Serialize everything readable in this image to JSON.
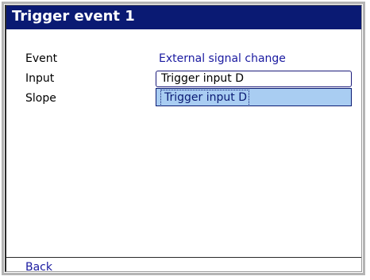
{
  "dialog": {
    "title": "Trigger event 1"
  },
  "fields": {
    "event_label": "Event",
    "event_value": "External signal change",
    "input_label": "Input",
    "input_value": "Trigger input D",
    "slope_label": "Slope"
  },
  "dropdown": {
    "options": [
      "Trigger input D"
    ],
    "highlighted": "Trigger input D"
  },
  "footer": {
    "back_label": "Back"
  },
  "colors": {
    "titlebar": "#0a1a73",
    "link_text": "#1a1aa0",
    "dropdown_highlight": "#a9cdf2"
  }
}
